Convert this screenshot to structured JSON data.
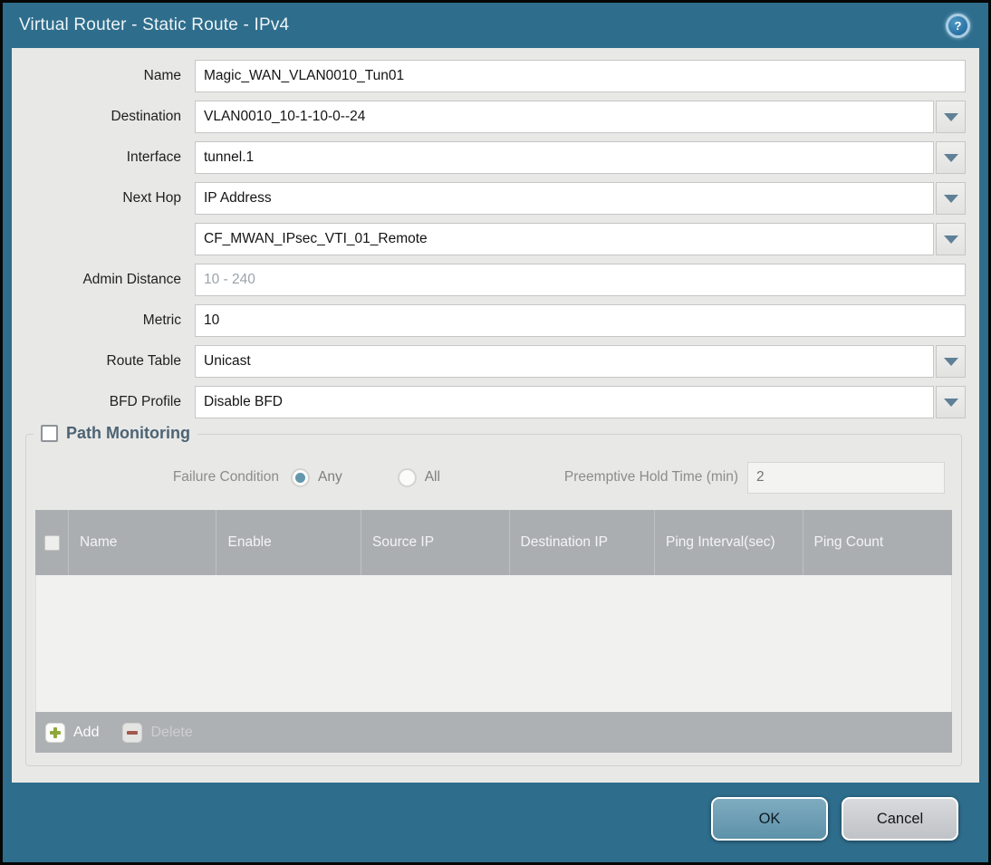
{
  "title_bar": {
    "title": "Virtual Router - Static Route - IPv4",
    "help_glyph": "?"
  },
  "form": {
    "name": {
      "label": "Name",
      "value": "Magic_WAN_VLAN0010_Tun01"
    },
    "destination": {
      "label": "Destination",
      "value": "VLAN0010_10-1-10-0--24"
    },
    "interface": {
      "label": "Interface",
      "value": "tunnel.1"
    },
    "next_hop": {
      "label": "Next Hop",
      "value": "IP Address"
    },
    "next_hop_address": {
      "value": "CF_MWAN_IPsec_VTI_01_Remote"
    },
    "admin_distance": {
      "label": "Admin Distance",
      "placeholder": "10 - 240",
      "value": ""
    },
    "metric": {
      "label": "Metric",
      "value": "10"
    },
    "route_table": {
      "label": "Route Table",
      "value": "Unicast"
    },
    "bfd_profile": {
      "label": "BFD Profile",
      "value": "Disable BFD"
    }
  },
  "path_monitoring": {
    "title": "Path Monitoring",
    "enabled": false,
    "failure_condition": {
      "label": "Failure Condition",
      "options": [
        {
          "label": "Any",
          "selected": true
        },
        {
          "label": "All",
          "selected": false
        }
      ]
    },
    "preemptive_hold_time": {
      "label": "Preemptive Hold Time (min)",
      "value": "2"
    },
    "table": {
      "columns": [
        "Name",
        "Enable",
        "Source IP",
        "Destination IP",
        "Ping Interval(sec)",
        "Ping Count"
      ],
      "rows": []
    },
    "toolbar": {
      "add": "Add",
      "delete": "Delete",
      "delete_disabled": true
    }
  },
  "footer": {
    "ok": "OK",
    "cancel": "Cancel"
  },
  "colors": {
    "frame_teal": "#2e6d8c",
    "content_bg": "#e8e8e7",
    "table_header_bg": "#abaeb1",
    "radio_selected": "#6397ae",
    "add_green": "#8fa83d",
    "delete_red": "#a2584e",
    "ok_button": "#6da1b6"
  }
}
